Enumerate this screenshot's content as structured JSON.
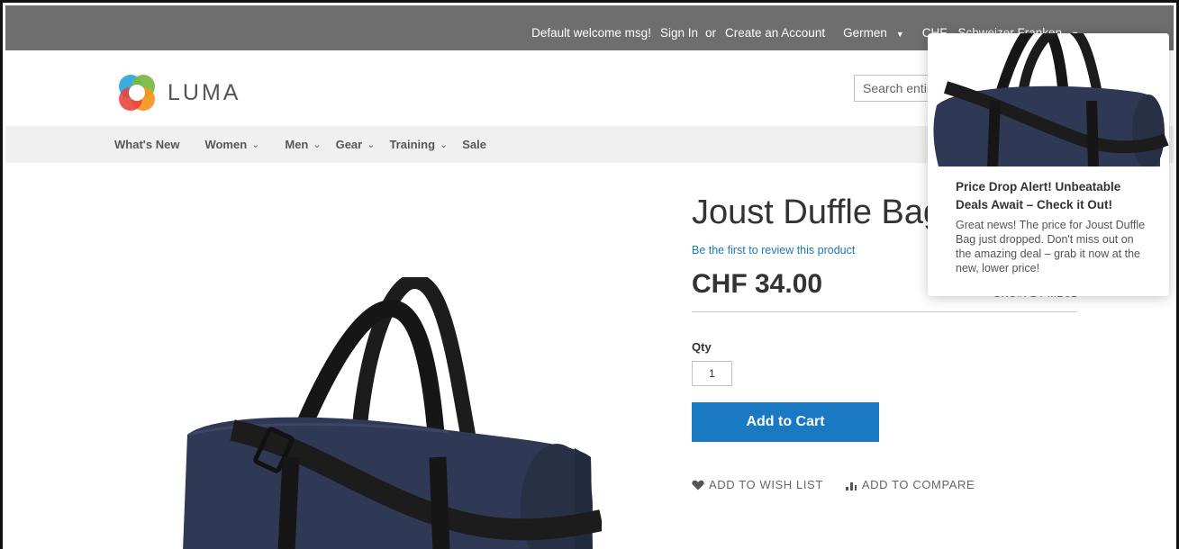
{
  "topbar": {
    "welcome": "Default welcome msg!",
    "sign_in": "Sign In",
    "or": "or",
    "create_account": "Create an Account",
    "store_view": "Germen",
    "currency": "CHF - Schweizer Franken"
  },
  "header": {
    "logo_text": "LUMA",
    "search_placeholder": "Search entire store here..."
  },
  "nav": {
    "items": [
      {
        "label": "What's New",
        "has_submenu": false
      },
      {
        "label": "Women",
        "has_submenu": true
      },
      {
        "label": "Men",
        "has_submenu": true
      },
      {
        "label": "Gear",
        "has_submenu": true
      },
      {
        "label": "Training",
        "has_submenu": true
      },
      {
        "label": "Sale",
        "has_submenu": false
      }
    ]
  },
  "product": {
    "title": "Joust Duffle Bag",
    "review_link": "Be the first to review this product",
    "price": "CHF 34.00",
    "sku": "SKU#:  24-MB01",
    "qty_label": "Qty",
    "qty_value": "1",
    "add_to_cart": "Add to Cart",
    "wishlist": "ADD TO WISH LIST",
    "compare": "ADD TO COMPARE"
  },
  "popup": {
    "title": "Price Drop Alert! Unbeatable Deals Await – Check it Out!",
    "body": "Great news! The price for Joust Duffle Bag just dropped. Don't miss out on the amazing deal – grab it now at the new, lower price!"
  },
  "colors": {
    "topbar": "#6e6e6e",
    "nav_bg": "#f0f0f0",
    "accent": "#1979c3",
    "bag": "#2f3854",
    "strap": "#1c1c1c"
  },
  "icons": [
    "luma-logo-icon",
    "chevron-down-icon",
    "heart-icon",
    "compare-icon"
  ]
}
